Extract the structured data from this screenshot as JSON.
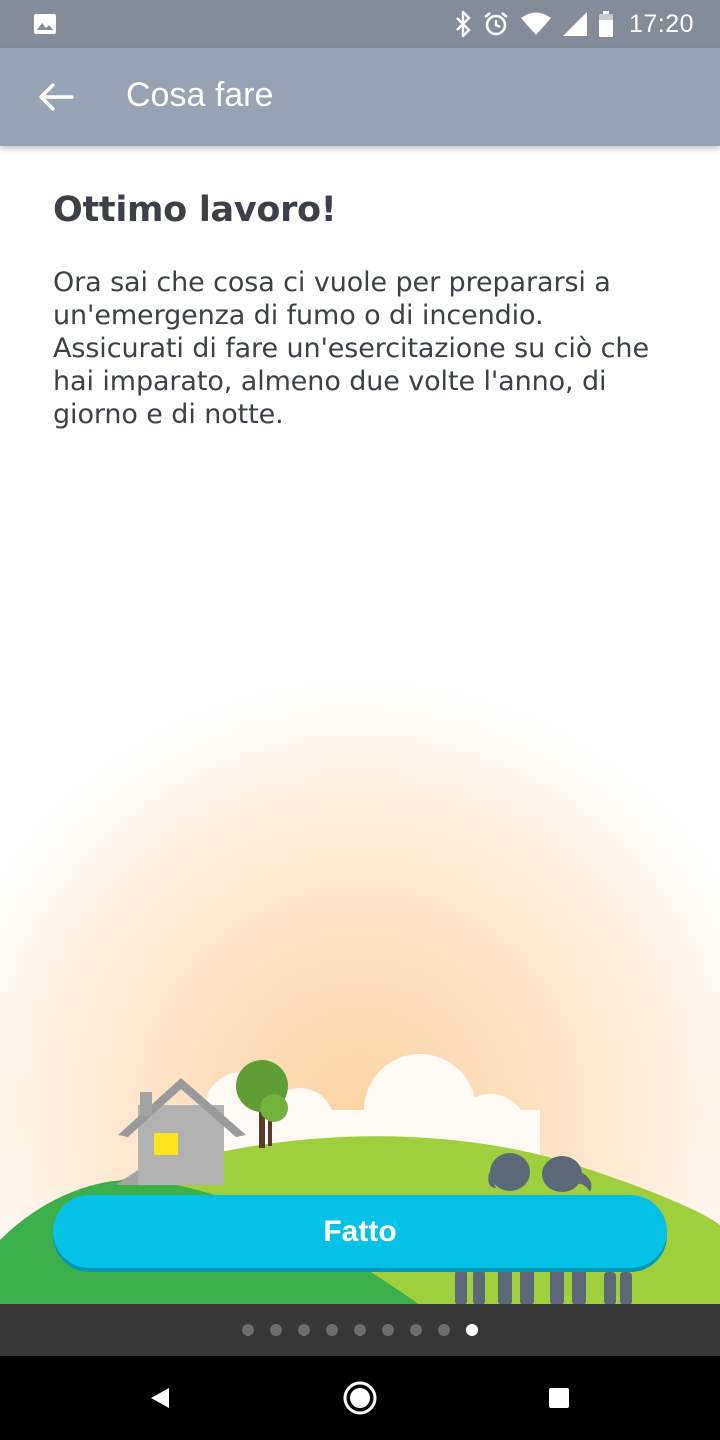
{
  "status_bar": {
    "time": "17:20",
    "icons": [
      "gallery-icon",
      "bluetooth-icon",
      "alarm-icon",
      "wifi-icon",
      "cell-signal-icon",
      "battery-icon"
    ]
  },
  "app_bar": {
    "title": "Cosa fare",
    "back_icon": "arrow-left-icon"
  },
  "main": {
    "heading": "Ottimo lavoro!",
    "body": "Ora sai che cosa ci vuole per prepararsi a un'emergenza di fumo o di incendio. Assicurati di fare un'esercitazione su ciò che hai imparato, almeno due volte l'anno, di giorno e di notte."
  },
  "done_button": {
    "label": "Fatto",
    "color": "#05c1e6"
  },
  "pager": {
    "total_pages": 9,
    "current_page": 9
  },
  "nav_bar": {
    "icons": [
      "back-triangle-icon",
      "home-circle-icon",
      "recents-square-icon"
    ]
  },
  "colors": {
    "status_bar": "#828d99",
    "app_bar": "#96a3b2",
    "text": "#3b4049",
    "hill_light": "#9fcf3c",
    "hill_dark": "#3daf4a"
  }
}
